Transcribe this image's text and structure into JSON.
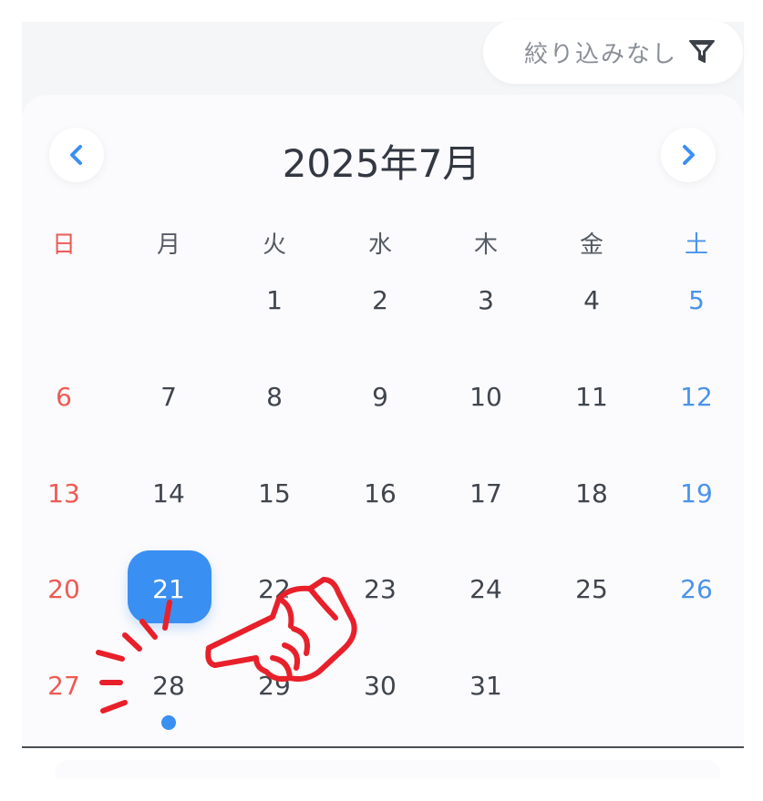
{
  "filter": {
    "label": "絞り込みなし",
    "icon": "filter-icon"
  },
  "calendar": {
    "title": "2025年7月",
    "prev_icon": "chevron-left-icon",
    "next_icon": "chevron-right-icon",
    "weekdays": [
      "日",
      "月",
      "火",
      "水",
      "木",
      "金",
      "土"
    ],
    "weeks": [
      [
        "",
        "",
        "1",
        "2",
        "3",
        "4",
        "5"
      ],
      [
        "6",
        "7",
        "8",
        "9",
        "10",
        "11",
        "12"
      ],
      [
        "13",
        "14",
        "15",
        "16",
        "17",
        "18",
        "19"
      ],
      [
        "20",
        "21",
        "22",
        "23",
        "24",
        "25",
        "26"
      ],
      [
        "27",
        "28",
        "29",
        "30",
        "31",
        "",
        ""
      ]
    ],
    "selected_day": "21",
    "event_days": [
      "28"
    ],
    "colors": {
      "accent": "#3a8ff2",
      "sunday": "#ee5a55",
      "saturday": "#4a93ea",
      "pointer": "#e8202a"
    }
  },
  "annotation": {
    "icon": "pointing-hand-icon"
  }
}
